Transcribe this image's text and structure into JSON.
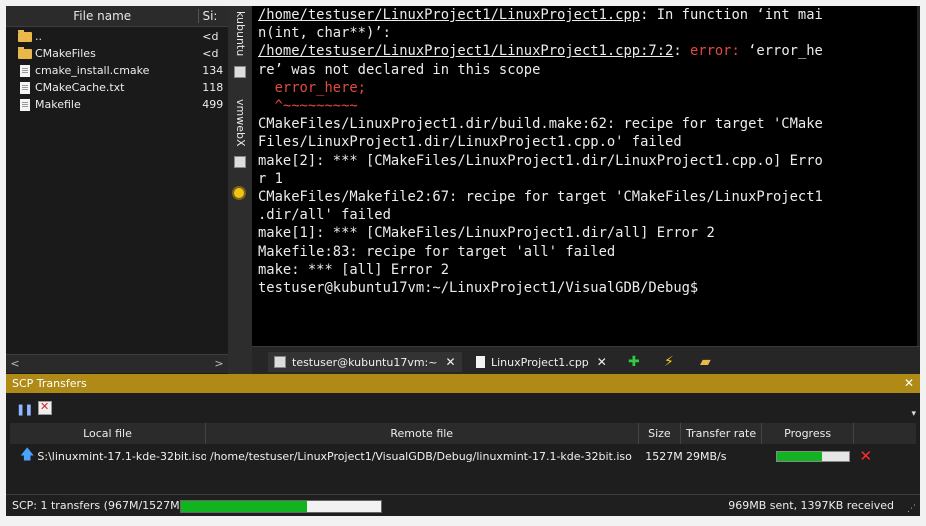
{
  "file_panel": {
    "col_name": "File name",
    "col_size": "Si:",
    "rows": [
      {
        "name": "..",
        "size": "<d",
        "kind": "folder"
      },
      {
        "name": "CMakeFiles",
        "size": "<d",
        "kind": "folder"
      },
      {
        "name": "cmake_install.cmake",
        "size": "134",
        "kind": "file"
      },
      {
        "name": "CMakeCache.txt",
        "size": "118",
        "kind": "file"
      },
      {
        "name": "Makefile",
        "size": "499",
        "kind": "file"
      }
    ],
    "scroll_left": "<",
    "scroll_right": ">"
  },
  "side_tabs": {
    "tab1": "kubuntu",
    "tab2": "vmwebX"
  },
  "terminal": {
    "l1_path": "/home/testuser/LinuxProject1/LinuxProject1.cpp",
    "l1_rest": ": In function ‘int mai",
    "l2": "n(int, char**)’:",
    "l3_path": "/home/testuser/LinuxProject1/LinuxProject1.cpp:7:2",
    "l3_colon": ": ",
    "l3_err": "error: ",
    "l3_rest": "‘error_he",
    "l4": "re’ was not declared in this scope",
    "l5": "  error_here;",
    "l6": "  ^~~~~~~~~~",
    "l7": "CMakeFiles/LinuxProject1.dir/build.make:62: recipe for target 'CMake",
    "l8": "Files/LinuxProject1.dir/LinuxProject1.cpp.o' failed",
    "l9": "make[2]: *** [CMakeFiles/LinuxProject1.dir/LinuxProject1.cpp.o] Erro",
    "l10": "r 1",
    "l11": "CMakeFiles/Makefile2:67: recipe for target 'CMakeFiles/LinuxProject1",
    "l12": ".dir/all' failed",
    "l13": "make[1]: *** [CMakeFiles/LinuxProject1.dir/all] Error 2",
    "l14": "Makefile:83: recipe for target 'all' failed",
    "l15": "make: *** [all] Error 2",
    "l16": "testuser@kubuntu17vm:~/LinuxProject1/VisualGDB/Debug$"
  },
  "doc_tabs": {
    "terminal_tab": "testuser@kubuntu17vm:~",
    "file_tab": "LinuxProject1.cpp",
    "close": "✕"
  },
  "scp": {
    "title": "SCP Transfers",
    "close": "✕",
    "columns": {
      "local": "Local file",
      "remote": "Remote file",
      "size": "Size",
      "rate": "Transfer rate",
      "progress": "Progress"
    },
    "rows": [
      {
        "local": "S:\\linuxmint-17.1-kde-32bit.iso",
        "remote": "/home/testuser/LinuxProject1/VisualGDB/Debug/linuxmint-17.1-kde-32bit.iso",
        "size": "1527M",
        "rate": "29MB/s",
        "progress": 0.63
      }
    ],
    "status_left": "SCP: 1 transfers (967M/1527M)",
    "status_progress": 0.63,
    "status_right": "969MB sent, 1397KB received"
  },
  "colors": {
    "accent_bar": "#b08a16",
    "error_red": "#e04b3f",
    "progress_green": "#12b320"
  }
}
